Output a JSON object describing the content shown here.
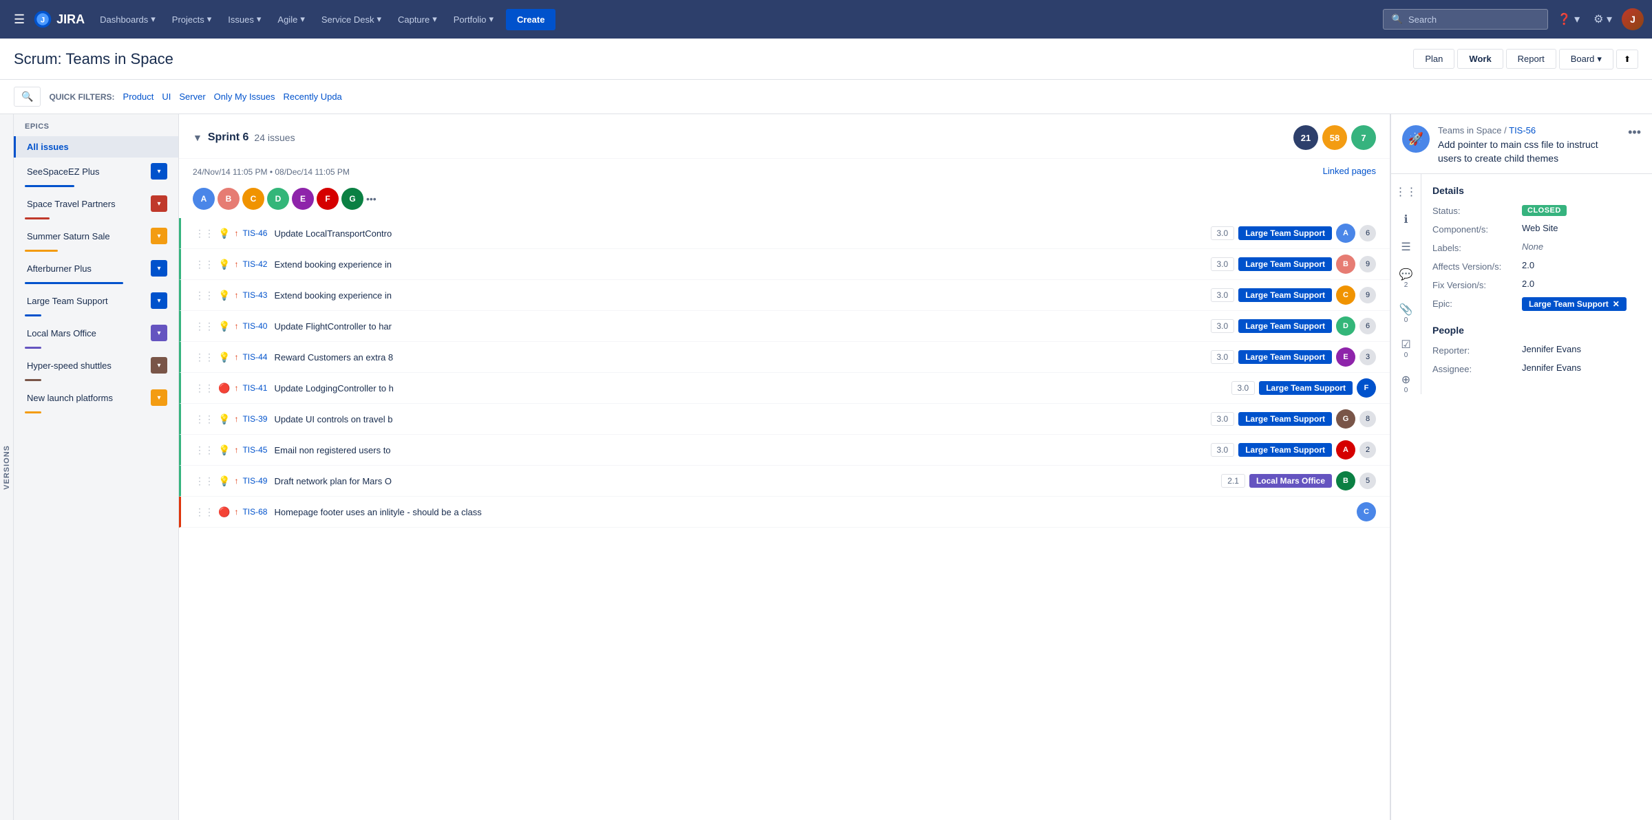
{
  "nav": {
    "hamburger": "☰",
    "logo_text": "JIRA",
    "items": [
      {
        "label": "Dashboards",
        "id": "dashboards"
      },
      {
        "label": "Projects",
        "id": "projects"
      },
      {
        "label": "Issues",
        "id": "issues"
      },
      {
        "label": "Agile",
        "id": "agile"
      },
      {
        "label": "Service Desk",
        "id": "service-desk"
      },
      {
        "label": "Capture",
        "id": "capture"
      },
      {
        "label": "Portfolio",
        "id": "portfolio"
      }
    ],
    "create_label": "Create",
    "search_placeholder": "Search",
    "help_label": "?",
    "settings_label": "⚙"
  },
  "subheader": {
    "title": "Scrum: Teams in Space",
    "buttons": [
      "Plan",
      "Work",
      "Report"
    ],
    "active_button": "Work",
    "board_label": "Board",
    "collapse_label": "⬆"
  },
  "filter_bar": {
    "quick_filters_label": "QUICK FILTERS:",
    "filters": [
      "Product",
      "UI",
      "Server",
      "Only My Issues",
      "Recently Upda"
    ]
  },
  "epics": {
    "header": "EPICS",
    "items": [
      {
        "label": "All issues",
        "active": true,
        "color": null,
        "bar_color": null
      },
      {
        "label": "SeeSpaceEZ Plus",
        "color": "#0052cc",
        "bar_color": "#0052cc",
        "bar_width": "30%"
      },
      {
        "label": "Space Travel Partners",
        "color": "#c0392b",
        "bar_color": "#c0392b",
        "bar_width": "15%"
      },
      {
        "label": "Summer Saturn Sale",
        "color": "#f39c12",
        "bar_color": "#f39c12",
        "bar_width": "20%"
      },
      {
        "label": "Afterburner Plus",
        "color": "#0052cc",
        "bar_color": "#0052cc",
        "bar_width": "60%"
      },
      {
        "label": "Large Team Support",
        "color": "#0052cc",
        "bar_color": "#0052cc",
        "bar_width": "10%"
      },
      {
        "label": "Local Mars Office",
        "color": "#6554c0",
        "bar_color": "#6554c0",
        "bar_width": "10%"
      },
      {
        "label": "Hyper-speed shuttles",
        "color": "#795548",
        "bar_color": "#795548",
        "bar_width": "10%"
      },
      {
        "label": "New launch platforms",
        "color": "#f39c12",
        "bar_color": "#f39c12",
        "bar_width": "10%"
      }
    ]
  },
  "sprint": {
    "chevron": "▼",
    "name": "Sprint 6",
    "issue_count": "24 issues",
    "badges": [
      {
        "count": "21",
        "color": "#2d3f6b"
      },
      {
        "count": "58",
        "color": "#f39c12"
      },
      {
        "count": "7",
        "color": "#36b37e"
      }
    ],
    "dates": "24/Nov/14 11:05 PM  •  08/Dec/14 11:05 PM",
    "linked_pages": "Linked pages",
    "more_dots": "..."
  },
  "issues": [
    {
      "border": "green",
      "icon": "💡",
      "priority": "↑",
      "key": "TIS-46",
      "summary": "Update LocalTransportContro",
      "points": "3.0",
      "epic": "Large Team Support",
      "epic_color": "#0052cc",
      "story_points": "6"
    },
    {
      "border": "green",
      "icon": "💡",
      "priority": "↑",
      "key": "TIS-42",
      "summary": "Extend booking experience in",
      "points": "3.0",
      "epic": "Large Team Support",
      "epic_color": "#0052cc",
      "story_points": "9"
    },
    {
      "border": "green",
      "icon": "💡",
      "priority": "↑",
      "key": "TIS-43",
      "summary": "Extend booking experience in",
      "points": "3.0",
      "epic": "Large Team Support",
      "epic_color": "#0052cc",
      "story_points": "9"
    },
    {
      "border": "green",
      "icon": "💡",
      "priority": "↑",
      "key": "TIS-40",
      "summary": "Update FlightController to har",
      "points": "3.0",
      "epic": "Large Team Support",
      "epic_color": "#0052cc",
      "story_points": "6"
    },
    {
      "border": "green",
      "icon": "💡",
      "priority": "↑",
      "key": "TIS-44",
      "summary": "Reward Customers an extra 8",
      "points": "3.0",
      "epic": "Large Team Support",
      "epic_color": "#0052cc",
      "story_points": "3"
    },
    {
      "border": "green",
      "icon": "🔴",
      "priority": "↑",
      "key": "TIS-41",
      "summary": "Update LodgingController to h",
      "points": "3.0",
      "epic": "Large Team Support",
      "epic_color": "#0052cc",
      "story_points": ""
    },
    {
      "border": "green",
      "icon": "💡",
      "priority": "↑",
      "key": "TIS-39",
      "summary": "Update UI controls on travel b",
      "points": "3.0",
      "epic": "Large Team Support",
      "epic_color": "#0052cc",
      "story_points": "8"
    },
    {
      "border": "green",
      "icon": "💡",
      "priority": "↑",
      "key": "TIS-45",
      "summary": "Email non registered users to",
      "points": "3.0",
      "epic": "Large Team Support",
      "epic_color": "#0052cc",
      "story_points": "2"
    },
    {
      "border": "green",
      "icon": "💡",
      "priority": "↑",
      "key": "TIS-49",
      "summary": "Draft network plan for Mars O",
      "points": "2.1",
      "epic": "Local Mars Office",
      "epic_color": "#6554c0",
      "story_points": "5"
    },
    {
      "border": "red",
      "icon": "🔴",
      "priority": "↑",
      "key": "TIS-68",
      "summary": "Homepage footer uses an inlityle - should be a class",
      "points": "",
      "epic": "",
      "epic_color": "",
      "story_points": ""
    }
  ],
  "detail": {
    "breadcrumb_project": "Teams in Space",
    "breadcrumb_separator": " / ",
    "issue_key": "TIS-56",
    "title": "Add pointer to main css file to instruct users to create child themes",
    "more_icon": "•••",
    "side_icons": [
      {
        "icon": "≡",
        "count": null
      },
      {
        "icon": "ℹ",
        "count": null
      },
      {
        "icon": "≡",
        "count": null
      },
      {
        "icon": "💬",
        "count": "2"
      },
      {
        "icon": "📎",
        "count": "0"
      },
      {
        "icon": "☑",
        "count": "0"
      },
      {
        "icon": "⊕",
        "count": "0"
      }
    ],
    "details_section": "Details",
    "status_label": "Status:",
    "status_value": "CLOSED",
    "components_label": "Component/s:",
    "components_value": "Web Site",
    "labels_label": "Labels:",
    "labels_value": "None",
    "affects_version_label": "Affects Version/s:",
    "affects_version_value": "2.0",
    "fix_version_label": "Fix Version/s:",
    "fix_version_value": "2.0",
    "epic_label": "Epic:",
    "epic_value": "Large Team Support",
    "people_section": "People",
    "reporter_label": "Reporter:",
    "reporter_value": "Jennifer Evans",
    "assignee_label": "Assignee:",
    "assignee_value": "Jennifer Evans"
  }
}
